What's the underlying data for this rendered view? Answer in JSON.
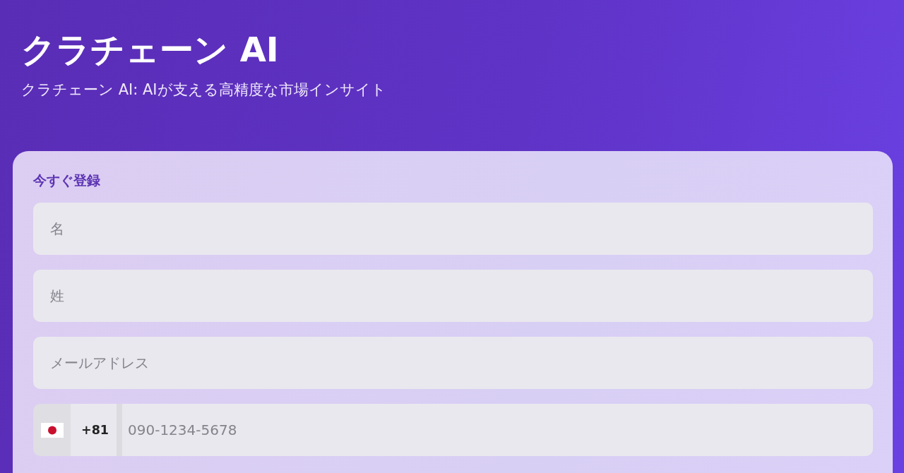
{
  "header": {
    "title": "クラチェーン AI",
    "subtitle": "クラチェーン AI: AIが支える高精度な市場インサイト"
  },
  "form": {
    "heading": "今すぐ登録",
    "fields": [
      {
        "kind": "text",
        "placeholder": "名"
      },
      {
        "kind": "text",
        "placeholder": "姓"
      },
      {
        "kind": "text",
        "placeholder": "メールアドレス"
      },
      {
        "kind": "phone",
        "dial_code": "+81",
        "placeholder": "090-1234-5678"
      }
    ]
  }
}
